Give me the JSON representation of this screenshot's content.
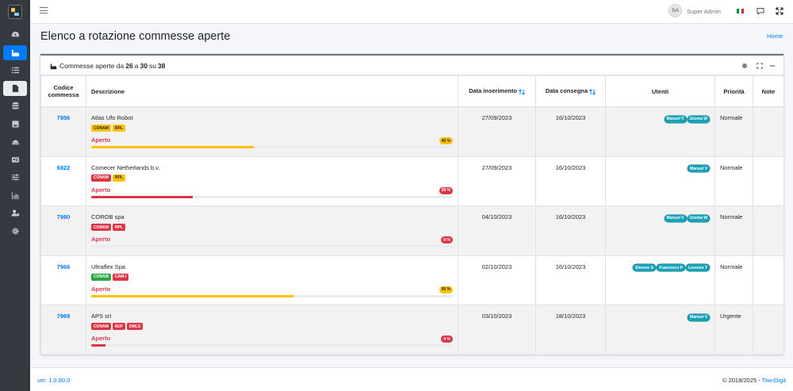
{
  "topbar": {
    "avatar_initials": "SA",
    "user_name": "Super Admin"
  },
  "page": {
    "title": "Elenco a rotazione commesse aperte",
    "breadcrumb": "Home"
  },
  "card": {
    "title_prefix": "Commesse aperte da",
    "from": "26",
    "sep1": "a",
    "to": "30",
    "sep2": "su",
    "total": "38"
  },
  "table": {
    "headers": {
      "code": "Codice commessa",
      "description": "Descrizione",
      "date_insert": "Data inserimento",
      "date_delivery": "Data consegna",
      "users": "Utenti",
      "priority": "Priorità",
      "notes": "Note"
    },
    "rows": [
      {
        "code": "7956",
        "name": "Atlas Ufo Robot",
        "tags": [
          {
            "label": "CONAM",
            "color": "#ffc107",
            "text": "#212529"
          },
          {
            "label": "RPL",
            "color": "#ffc107",
            "text": "#212529"
          }
        ],
        "status": "Aperto",
        "percent_label": "45 %",
        "progress": 0.45,
        "bar_color": "#ffc107",
        "badge_text_color": "#212529",
        "date_insert": "27/09/2023",
        "date_delivery": "16/10/2023",
        "users": [
          "Manuel V",
          "Uzoma W"
        ],
        "priority": "Normale",
        "notes": ""
      },
      {
        "code": "6822",
        "name": "Comecer Netherlands b.v.",
        "tags": [
          {
            "label": "CONAM",
            "color": "#dc3545",
            "text": "#ffffff"
          },
          {
            "label": "RPL",
            "color": "#ffc107",
            "text": "#212529"
          }
        ],
        "status": "Aperto",
        "percent_label": "28 %",
        "progress": 0.28,
        "bar_color": "#dc3545",
        "badge_text_color": "#ffffff",
        "date_insert": "27/09/2023",
        "date_delivery": "16/10/2023",
        "users": [
          "Manuel V"
        ],
        "priority": "Normale",
        "notes": ""
      },
      {
        "code": "7980",
        "name": "COROB spa",
        "tags": [
          {
            "label": "CONAM",
            "color": "#dc3545",
            "text": "#ffffff"
          },
          {
            "label": "RPL",
            "color": "#dc3545",
            "text": "#ffffff"
          }
        ],
        "status": "Aperto",
        "percent_label": "0 %",
        "progress": 0.0,
        "bar_color": "#dc3545",
        "badge_text_color": "#ffffff",
        "date_insert": "04/10/2023",
        "date_delivery": "16/10/2023",
        "users": [
          "Manuel V",
          "Uzoma W"
        ],
        "priority": "Normale",
        "notes": ""
      },
      {
        "code": "7966",
        "name": "Ultraflex Spa",
        "tags": [
          {
            "label": "CONAM",
            "color": "#28a745",
            "text": "#ffffff"
          },
          {
            "label": "CAM-I",
            "color": "#dc3545",
            "text": "#ffffff"
          }
        ],
        "status": "Aperto",
        "percent_label": "56 %",
        "progress": 0.56,
        "bar_color": "#ffc107",
        "badge_text_color": "#212529",
        "date_insert": "02/10/2023",
        "date_delivery": "16/10/2023",
        "users": [
          "Simone G",
          "Francesco P",
          "Lorenzo T"
        ],
        "priority": "Normale",
        "notes": ""
      },
      {
        "code": "7969",
        "name": "APS srl",
        "tags": [
          {
            "label": "CONAM",
            "color": "#dc3545",
            "text": "#ffffff"
          },
          {
            "label": "MJF",
            "color": "#dc3545",
            "text": "#ffffff"
          },
          {
            "label": "DMLS",
            "color": "#dc3545",
            "text": "#ffffff"
          }
        ],
        "status": "Aperto",
        "percent_label": "4 %",
        "progress": 0.04,
        "bar_color": "#dc3545",
        "badge_text_color": "#ffffff",
        "date_insert": "03/10/2023",
        "date_delivery": "18/10/2023",
        "users": [
          "Manuel V"
        ],
        "priority": "Urgente",
        "notes": ""
      }
    ]
  },
  "footer": {
    "version": "ver. 1.0.80.0",
    "copyright": "© 2018/2025 - ",
    "company": "TwinDigit"
  },
  "colors": {
    "sidebar": "#343a40",
    "accent": "#007bff",
    "badge_user": "#17a2b8",
    "danger": "#dc3545",
    "warning": "#ffc107"
  },
  "icons": {
    "sidebar": [
      "dashboard-icon",
      "factory-icon",
      "list-icon",
      "file-invoice-icon",
      "database-icon",
      "image-icon",
      "conveyor-icon",
      "id-card-icon",
      "sliders-icon",
      "chart-icon",
      "user-settings-icon",
      "gear-icon"
    ],
    "topbar": [
      "hamburger-icon",
      "italy-flag-icon",
      "comment-icon",
      "expand-icon"
    ],
    "card": [
      "factory-icon",
      "gear-icon",
      "maximize-icon",
      "minus-icon"
    ]
  }
}
